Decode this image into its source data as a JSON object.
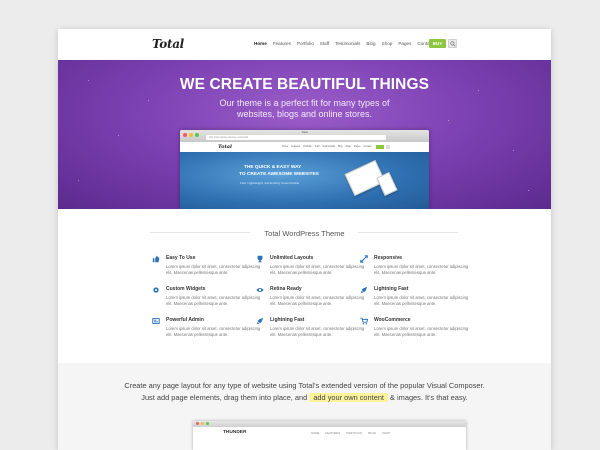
{
  "header": {
    "logo": "Total",
    "nav": [
      "Home",
      "Features",
      "Portfolio",
      "Staff",
      "Testimonials",
      "Blog",
      "Shop",
      "Pages",
      "Contact"
    ],
    "buy_button": "BUY"
  },
  "hero": {
    "title": "WE CREATE BEAUTIFUL THINGS",
    "subtitle_line1": "Our theme is a perfect fit for many types of",
    "subtitle_line2": "websites, blogs and online stores."
  },
  "hero_mockup": {
    "window_title": "Total",
    "url": "http://wpexplorer-themes.com/total/",
    "logo": "Total",
    "nav": [
      "Home",
      "Features",
      "Portfolio",
      "Staff",
      "Testimonials",
      "Blog",
      "Shop",
      "Pages",
      "Contact"
    ],
    "headline_line1": "THE QUICK & EASY WAY",
    "headline_line2": "TO CREATE AWESOME WEBSITES",
    "tagline": "Fast, Lightweight, and Entirely Customizable"
  },
  "features": {
    "section_title": "Total WordPress Theme",
    "items": [
      {
        "icon": "thumbs-up-icon",
        "title": "Easy To Use",
        "text": "Lorem ipsum dolor sit amet, consectetur adipiscing elit. Maecenas pellentesque ante."
      },
      {
        "icon": "trophy-icon",
        "title": "Unlimited Layouts",
        "text": "Lorem ipsum dolor sit amet, consectetur adipiscing elit. Maecenas pellentesque ante."
      },
      {
        "icon": "resize-icon",
        "title": "Responsive",
        "text": "Lorem ipsum dolor sit amet, consectetur adipiscing elit. Maecenas pellentesque ante."
      },
      {
        "icon": "gear-icon",
        "title": "Custom Widgets",
        "text": "Lorem ipsum dolor sit amet, consectetur adipiscing elit. Maecenas pellentesque ante."
      },
      {
        "icon": "eye-icon",
        "title": "Retina Ready",
        "text": "Lorem ipsum dolor sit amet, consectetur adipiscing elit. Maecenas pellentesque ante."
      },
      {
        "icon": "rocket-icon",
        "title": "Lightning Fast",
        "text": "Lorem ipsum dolor sit amet, consectetur adipiscing elit. Maecenas pellentesque ante."
      },
      {
        "icon": "admin-icon",
        "title": "Powerful Admin",
        "text": "Lorem ipsum dolor sit amet, consectetur adipiscing elit. Maecenas pellentesque ante."
      },
      {
        "icon": "rocket-icon",
        "title": "Lightning Fast",
        "text": "Lorem ipsum dolor sit amet, consectetur adipiscing elit. Maecenas pellentesque ante."
      },
      {
        "icon": "cart-icon",
        "title": "WooCommerce",
        "text": "Lorem ipsum dolor sit amet, consectetur adipiscing elit. Maecenas pellentesque ante."
      }
    ]
  },
  "lower": {
    "text_before": "Create any page layout for any type of website using Total's extended version of the popular Visual Composer. Just add page elements, drag them into place, and",
    "highlight": "add your own content",
    "text_after": "& images. It's that easy."
  },
  "lower_mockup": {
    "logo": "THUNDER",
    "nav": [
      "HOME",
      "FEATURES",
      "PORTFOLIO",
      "BLOG",
      "SHOP"
    ]
  },
  "colors": {
    "accent_purple": "#7e42b4",
    "buy_green": "#8dc63f",
    "feature_icon_blue": "#2b72b9",
    "highlight_yellow": "#fcf29a"
  }
}
